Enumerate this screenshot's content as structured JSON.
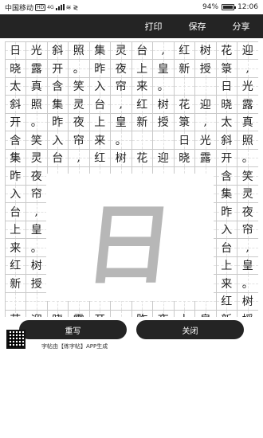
{
  "status_bar": {
    "carrier": "中国移动",
    "hd": "HD",
    "network": "4G",
    "battery": "94%",
    "time": "12:06"
  },
  "toolbar": {
    "print": "打印",
    "save": "保存",
    "share": "分享"
  },
  "grid": {
    "cells": [
      "日",
      "光",
      "斜",
      "照",
      "集",
      "灵",
      "台",
      ",",
      "红",
      "树",
      "花",
      "迎",
      "晓",
      "露",
      "开",
      "。",
      "昨",
      "夜",
      "上",
      "皇",
      "新",
      "授",
      "箓",
      ",",
      "太",
      "真",
      "含",
      "笑",
      "入",
      "帘",
      "来",
      "。",
      "",
      "",
      "日",
      "光",
      "斜",
      "照",
      "集",
      "灵",
      "台",
      ",",
      "红",
      "树",
      "花",
      "迎",
      "晓",
      "露",
      "开",
      "。",
      "昨",
      "夜",
      "上",
      "皇",
      "新",
      "授",
      "箓",
      ",",
      "太",
      "真",
      "含",
      "笑",
      "入",
      "帘",
      "来",
      "。",
      "",
      "",
      "日",
      "光",
      "斜",
      "照",
      "集",
      "灵",
      "台",
      ",",
      "红",
      "树",
      "花",
      "迎",
      "晓",
      "露",
      "开",
      "。",
      "昨",
      "夜",
      "",
      "",
      "",
      "",
      "",
      "",
      "",
      "",
      "含",
      "笑",
      "入",
      "帘",
      "",
      "",
      "",
      "",
      "",
      "",
      "",
      "",
      "集",
      "灵",
      "台",
      ",",
      "",
      "",
      "",
      "",
      "",
      "",
      "",
      "",
      "昨",
      "夜",
      "上",
      "皇",
      "",
      "",
      "",
      "",
      "",
      "",
      "",
      "",
      "入",
      "帘",
      "来",
      "。",
      "",
      "",
      "",
      "",
      "",
      "",
      "",
      "",
      "台",
      ",",
      "红",
      "树",
      "",
      "",
      "",
      "",
      "",
      "",
      "",
      "",
      "上",
      "皇",
      "新",
      "授",
      "",
      "",
      "",
      "",
      "",
      "",
      "",
      "",
      "来",
      "。",
      "",
      "",
      "",
      "",
      "",
      "",
      "",
      "",
      "",
      "",
      "红",
      "树",
      "花",
      "迎",
      "晓",
      "露",
      "开",
      "。",
      "昨",
      "夜",
      "上",
      "皇",
      "新",
      "授"
    ]
  },
  "overlay": {
    "character": "日"
  },
  "bottom": {
    "rewrite": "重写",
    "close": "关闭",
    "credit": "字帖由【练字帖】APP生成"
  }
}
